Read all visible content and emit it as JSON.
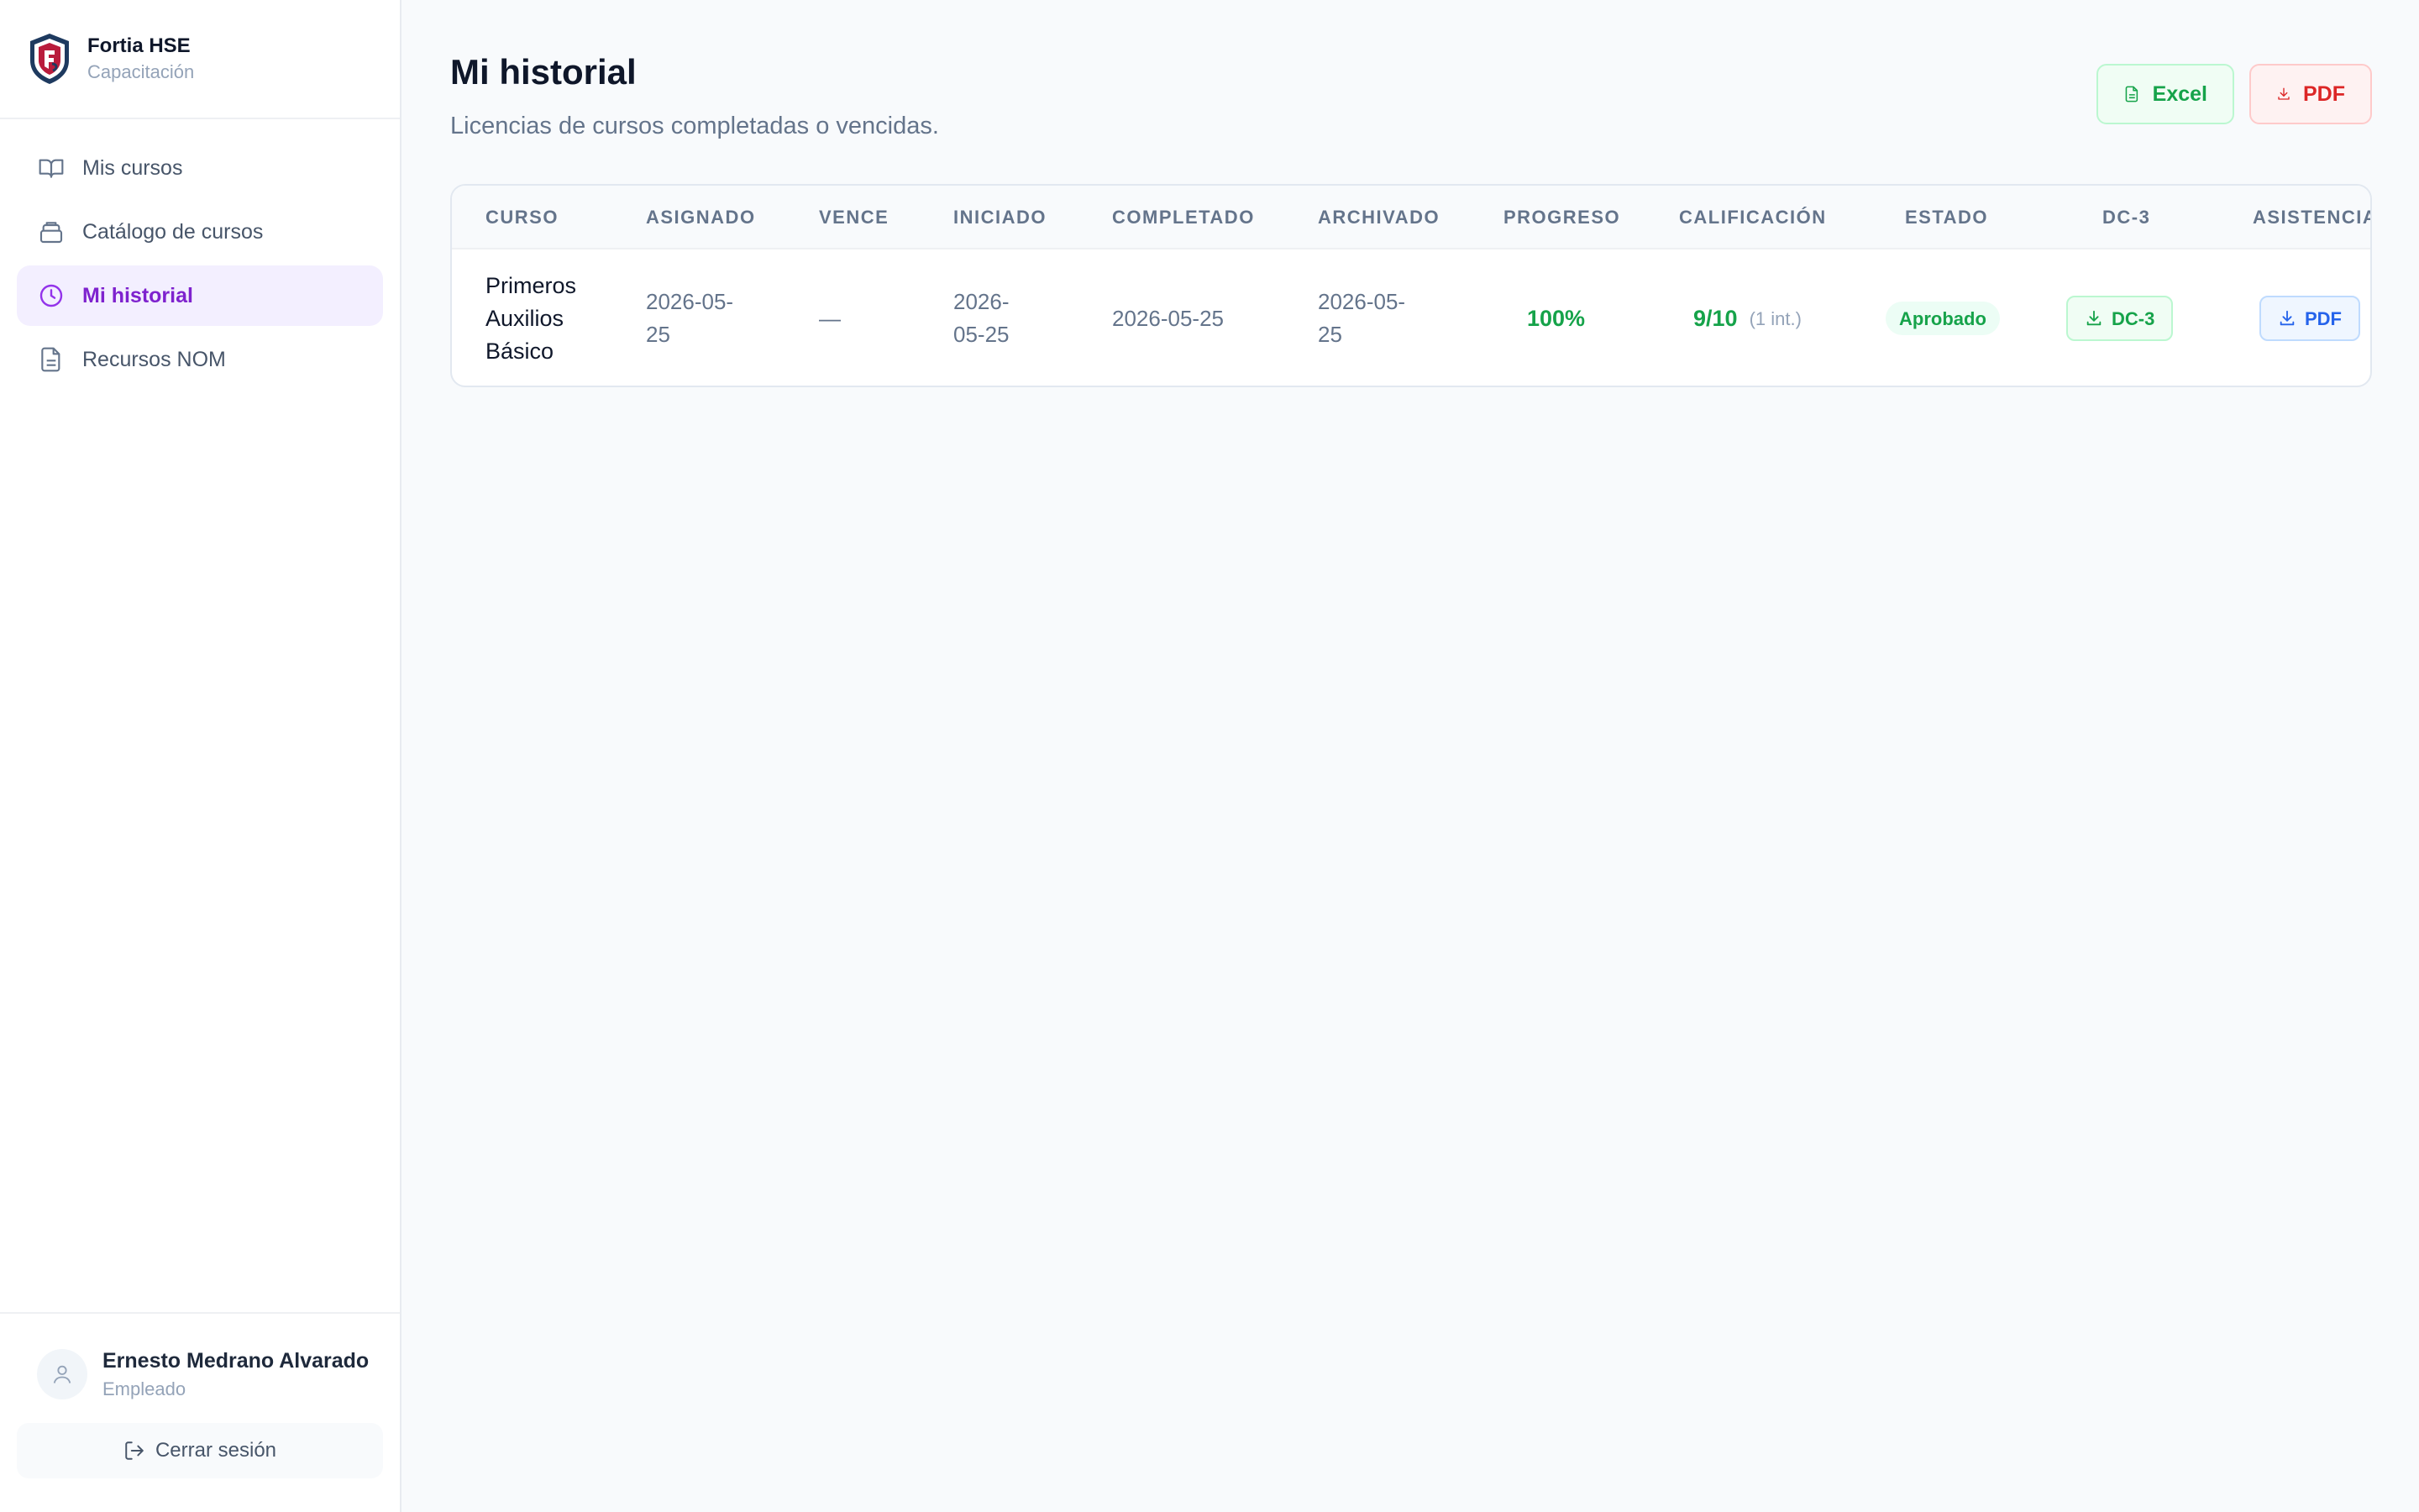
{
  "brand": {
    "name": "Fortia HSE",
    "subtitle": "Capacitación"
  },
  "nav": {
    "items": [
      {
        "label": "Mis cursos",
        "icon": "book-open-icon"
      },
      {
        "label": "Catálogo de cursos",
        "icon": "catalog-icon"
      },
      {
        "label": "Mi historial",
        "icon": "clock-icon",
        "active": true
      },
      {
        "label": "Recursos NOM",
        "icon": "document-icon"
      }
    ]
  },
  "user": {
    "name": "Ernesto Medrano Alvarado",
    "role": "Empleado",
    "logout_label": "Cerrar sesión"
  },
  "page": {
    "title": "Mi historial",
    "subtitle": "Licencias de cursos completadas o vencidas."
  },
  "actions": {
    "excel_label": "Excel",
    "pdf_label": "PDF"
  },
  "table": {
    "headers": [
      "CURSO",
      "ASIGNADO",
      "VENCE",
      "INICIADO",
      "COMPLETADO",
      "ARCHIVADO",
      "PROGRESO",
      "CALIFICACIÓN",
      "ESTADO",
      "DC-3",
      "ASISTENCIA"
    ],
    "rows": [
      {
        "course_line1": "Primeros",
        "course_line2": "Auxilios",
        "course_line3": "Básico",
        "assigned_line1": "2026-05-",
        "assigned_line2": "25",
        "expires": "—",
        "started_line1": "2026-",
        "started_line2": "05-25",
        "completed": "2026-05-25",
        "archived_line1": "2026-05-",
        "archived_line2": "25",
        "progress": "100%",
        "grade": "9/10",
        "attempts": "(1 int.)",
        "status": "Aprobado",
        "dc3_label": "DC-3",
        "attendance_label": "PDF"
      }
    ]
  },
  "colors": {
    "accent_purple": "#7e22ce",
    "success_green": "#16a34a",
    "danger_red": "#dc2626",
    "info_blue": "#2563eb"
  }
}
